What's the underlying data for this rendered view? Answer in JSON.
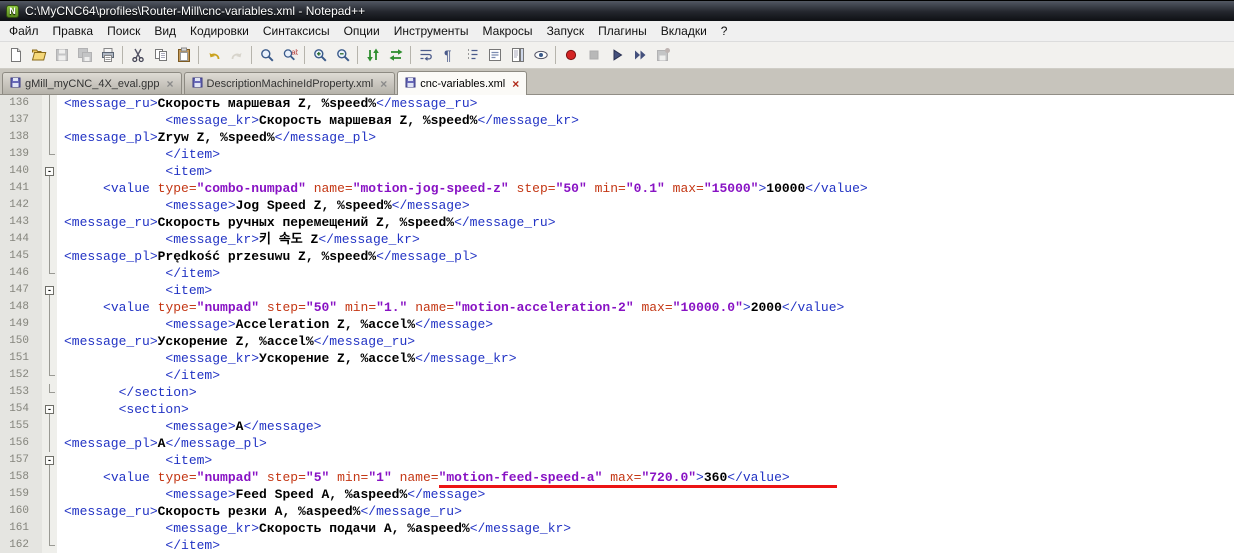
{
  "window": {
    "title": "C:\\MyCNC64\\profiles\\Router-Mill\\cnc-variables.xml - Notepad++",
    "app_icon": "notepad-plus-plus"
  },
  "colors": {
    "tag": "#2233c4",
    "attr": "#c43714",
    "value": "#8812c4",
    "text": "#000000",
    "underline": "#ec1414"
  },
  "menubar": {
    "items": [
      "Файл",
      "Правка",
      "Поиск",
      "Вид",
      "Кодировки",
      "Синтаксисы",
      "Опции",
      "Инструменты",
      "Макросы",
      "Запуск",
      "Плагины",
      "Вкладки",
      "?"
    ]
  },
  "toolbar": {
    "buttons": [
      {
        "name": "new-file",
        "sep": false,
        "disabled": false
      },
      {
        "name": "open-folder",
        "sep": false,
        "disabled": false
      },
      {
        "name": "save",
        "sep": false,
        "disabled": true
      },
      {
        "name": "save-all",
        "sep": false,
        "disabled": true
      },
      {
        "name": "print",
        "sep": false,
        "disabled": false
      },
      {
        "name": "cut",
        "sep": true,
        "disabled": false
      },
      {
        "name": "copy",
        "sep": false,
        "disabled": false
      },
      {
        "name": "paste",
        "sep": false,
        "disabled": false
      },
      {
        "name": "undo",
        "sep": true,
        "disabled": false
      },
      {
        "name": "redo",
        "sep": false,
        "disabled": true
      },
      {
        "name": "find",
        "sep": true,
        "disabled": false
      },
      {
        "name": "replace",
        "sep": false,
        "disabled": false
      },
      {
        "name": "zoom-in",
        "sep": true,
        "disabled": false
      },
      {
        "name": "zoom-out",
        "sep": false,
        "disabled": false
      },
      {
        "name": "sync-vertical",
        "sep": true,
        "disabled": false
      },
      {
        "name": "sync-horizontal",
        "sep": false,
        "disabled": false
      },
      {
        "name": "word-wrap",
        "sep": true,
        "disabled": false
      },
      {
        "name": "show-all-characters",
        "sep": false,
        "disabled": false
      },
      {
        "name": "indent-guide",
        "sep": false,
        "disabled": false
      },
      {
        "name": "function-list",
        "sep": false,
        "disabled": false
      },
      {
        "name": "doc-map",
        "sep": false,
        "disabled": false
      },
      {
        "name": "preview-eye",
        "sep": false,
        "disabled": false
      },
      {
        "name": "record-macro",
        "sep": true,
        "disabled": false
      },
      {
        "name": "stop-record",
        "sep": false,
        "disabled": true
      },
      {
        "name": "playback-macro",
        "sep": false,
        "disabled": false
      },
      {
        "name": "run-macro-multiple",
        "sep": false,
        "disabled": false
      },
      {
        "name": "save-macro",
        "sep": false,
        "disabled": true
      }
    ]
  },
  "tabs": {
    "close_glyph": "×",
    "items": [
      {
        "label": "gMill_myCNC_4X_eval.gpp",
        "active": false
      },
      {
        "label": "DescriptionMachineIdProperty.xml",
        "active": false
      },
      {
        "label": "cnc-variables.xml",
        "active": true
      }
    ]
  },
  "annotation": {
    "type": "red-underline",
    "line": 158,
    "color": "#ec1414"
  },
  "editor": {
    "first_line": 136,
    "last_line": 162,
    "lines": [
      {
        "n": 136,
        "fold": "v",
        "seg": [
          [
            "t",
            "<message_ru>"
          ],
          [
            "x",
            "Скорость маршевая Z, %speed%"
          ],
          [
            "t",
            "</message_ru>"
          ]
        ]
      },
      {
        "n": 137,
        "fold": "v",
        "seg": [
          [
            "p",
            "             "
          ],
          [
            "t",
            "<message_kr>"
          ],
          [
            "x",
            "Скорость маршевая Z, %speed%"
          ],
          [
            "t",
            "</message_kr>"
          ]
        ]
      },
      {
        "n": 138,
        "fold": "v",
        "seg": [
          [
            "t",
            "<message_pl>"
          ],
          [
            "x",
            "Zryw Z, %speed%"
          ],
          [
            "t",
            "</message_pl>"
          ]
        ]
      },
      {
        "n": 139,
        "fold": "corner",
        "seg": [
          [
            "p",
            "             "
          ],
          [
            "t",
            "</item>"
          ]
        ]
      },
      {
        "n": 140,
        "fold": "box",
        "seg": [
          [
            "p",
            "             "
          ],
          [
            "t",
            "<item>"
          ]
        ]
      },
      {
        "n": 141,
        "fold": "v",
        "seg": [
          [
            "p",
            "     "
          ],
          [
            "t",
            "<value"
          ],
          [
            "p",
            " "
          ],
          [
            "a",
            "type="
          ],
          [
            "v",
            "\"combo-numpad\""
          ],
          [
            "p",
            " "
          ],
          [
            "a",
            "name="
          ],
          [
            "v",
            "\"motion-jog-speed-z\""
          ],
          [
            "p",
            " "
          ],
          [
            "a",
            "step="
          ],
          [
            "v",
            "\"50\""
          ],
          [
            "p",
            " "
          ],
          [
            "a",
            "min="
          ],
          [
            "v",
            "\"0.1\""
          ],
          [
            "p",
            " "
          ],
          [
            "a",
            "max="
          ],
          [
            "v",
            "\"15000\""
          ],
          [
            "t",
            ">"
          ],
          [
            "x",
            "10000"
          ],
          [
            "t",
            "</value>"
          ]
        ]
      },
      {
        "n": 142,
        "fold": "v",
        "seg": [
          [
            "p",
            "             "
          ],
          [
            "t",
            "<message>"
          ],
          [
            "x",
            "Jog Speed Z, %speed%"
          ],
          [
            "t",
            "</message>"
          ]
        ]
      },
      {
        "n": 143,
        "fold": "v",
        "seg": [
          [
            "t",
            "<message_ru>"
          ],
          [
            "x",
            "Скорость ручных перемещений Z, %speed%"
          ],
          [
            "t",
            "</message_ru>"
          ]
        ]
      },
      {
        "n": 144,
        "fold": "v",
        "seg": [
          [
            "p",
            "             "
          ],
          [
            "t",
            "<message_kr>"
          ],
          [
            "x",
            "키 속도 Z"
          ],
          [
            "t",
            "</message_kr>"
          ]
        ]
      },
      {
        "n": 145,
        "fold": "v",
        "seg": [
          [
            "t",
            "<message_pl>"
          ],
          [
            "x",
            "Prędkość przesuwu Z, %speed%"
          ],
          [
            "t",
            "</message_pl>"
          ]
        ]
      },
      {
        "n": 146,
        "fold": "corner",
        "seg": [
          [
            "p",
            "             "
          ],
          [
            "t",
            "</item>"
          ]
        ]
      },
      {
        "n": 147,
        "fold": "box",
        "seg": [
          [
            "p",
            "             "
          ],
          [
            "t",
            "<item>"
          ]
        ]
      },
      {
        "n": 148,
        "fold": "v",
        "seg": [
          [
            "p",
            "     "
          ],
          [
            "t",
            "<value"
          ],
          [
            "p",
            " "
          ],
          [
            "a",
            "type="
          ],
          [
            "v",
            "\"numpad\""
          ],
          [
            "p",
            " "
          ],
          [
            "a",
            "step="
          ],
          [
            "v",
            "\"50\""
          ],
          [
            "p",
            " "
          ],
          [
            "a",
            "min="
          ],
          [
            "v",
            "\"1.\""
          ],
          [
            "p",
            " "
          ],
          [
            "a",
            "name="
          ],
          [
            "v",
            "\"motion-acceleration-2\""
          ],
          [
            "p",
            " "
          ],
          [
            "a",
            "max="
          ],
          [
            "v",
            "\"10000.0\""
          ],
          [
            "t",
            ">"
          ],
          [
            "x",
            "2000"
          ],
          [
            "t",
            "</value>"
          ]
        ]
      },
      {
        "n": 149,
        "fold": "v",
        "seg": [
          [
            "p",
            "             "
          ],
          [
            "t",
            "<message>"
          ],
          [
            "x",
            "Acceleration Z, %accel%"
          ],
          [
            "t",
            "</message>"
          ]
        ]
      },
      {
        "n": 150,
        "fold": "v",
        "seg": [
          [
            "t",
            "<message_ru>"
          ],
          [
            "x",
            "Ускорение Z, %accel%"
          ],
          [
            "t",
            "</message_ru>"
          ]
        ]
      },
      {
        "n": 151,
        "fold": "v",
        "seg": [
          [
            "p",
            "             "
          ],
          [
            "t",
            "<message_kr>"
          ],
          [
            "x",
            "Ускорение Z, %accel%"
          ],
          [
            "t",
            "</message_kr>"
          ]
        ]
      },
      {
        "n": 152,
        "fold": "corner",
        "seg": [
          [
            "p",
            "             "
          ],
          [
            "t",
            "</item>"
          ]
        ]
      },
      {
        "n": 153,
        "fold": "corner",
        "seg": [
          [
            "p",
            "       "
          ],
          [
            "t",
            "</section>"
          ]
        ]
      },
      {
        "n": 154,
        "fold": "box",
        "seg": [
          [
            "p",
            "       "
          ],
          [
            "t",
            "<section>"
          ]
        ]
      },
      {
        "n": 155,
        "fold": "v",
        "seg": [
          [
            "p",
            "             "
          ],
          [
            "t",
            "<message>"
          ],
          [
            "x",
            "A"
          ],
          [
            "t",
            "</message>"
          ]
        ]
      },
      {
        "n": 156,
        "fold": "v",
        "seg": [
          [
            "t",
            "<message_pl>"
          ],
          [
            "x",
            "A"
          ],
          [
            "t",
            "</message_pl>"
          ]
        ]
      },
      {
        "n": 157,
        "fold": "box",
        "seg": [
          [
            "p",
            "             "
          ],
          [
            "t",
            "<item>"
          ]
        ]
      },
      {
        "n": 158,
        "fold": "v",
        "seg": [
          [
            "p",
            "     "
          ],
          [
            "t",
            "<value"
          ],
          [
            "p",
            " "
          ],
          [
            "a",
            "type="
          ],
          [
            "v",
            "\"numpad\""
          ],
          [
            "p",
            " "
          ],
          [
            "a",
            "step="
          ],
          [
            "v",
            "\"5\""
          ],
          [
            "p",
            " "
          ],
          [
            "a",
            "min="
          ],
          [
            "v",
            "\"1\""
          ],
          [
            "p",
            " "
          ],
          [
            "a",
            "name="
          ],
          [
            "v",
            "\"motion-feed-speed-a\"",
            1
          ],
          [
            "p",
            " ",
            1
          ],
          [
            "a",
            "max=",
            1
          ],
          [
            "v",
            "\"720.0\"",
            1
          ],
          [
            "t",
            ">",
            1
          ],
          [
            "x",
            "360",
            1
          ],
          [
            "t",
            "</value>",
            1
          ],
          [
            "p",
            "      ",
            1
          ]
        ]
      },
      {
        "n": 159,
        "fold": "v",
        "seg": [
          [
            "p",
            "             "
          ],
          [
            "t",
            "<message>"
          ],
          [
            "x",
            "Feed Speed A, %aspeed%"
          ],
          [
            "t",
            "</message>"
          ]
        ]
      },
      {
        "n": 160,
        "fold": "v",
        "seg": [
          [
            "t",
            "<message_ru>"
          ],
          [
            "x",
            "Скорость резки A, %aspeed%"
          ],
          [
            "t",
            "</message_ru>"
          ]
        ]
      },
      {
        "n": 161,
        "fold": "v",
        "seg": [
          [
            "p",
            "             "
          ],
          [
            "t",
            "<message_kr>"
          ],
          [
            "x",
            "Скорость подачи A, %aspeed%"
          ],
          [
            "t",
            "</message_kr>"
          ]
        ]
      },
      {
        "n": 162,
        "fold": "corner",
        "seg": [
          [
            "p",
            "             "
          ],
          [
            "t",
            "</item>"
          ]
        ]
      }
    ]
  }
}
